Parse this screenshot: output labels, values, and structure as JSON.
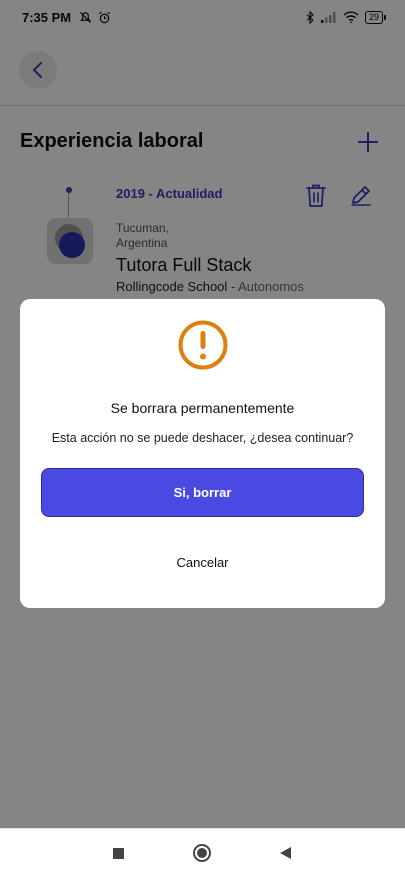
{
  "status_bar": {
    "time": "7:35 PM",
    "battery": "29",
    "icons": [
      "mute-icon",
      "alarm-icon",
      "bluetooth-icon",
      "signal-icon",
      "wifi-icon",
      "battery-icon"
    ]
  },
  "header": {
    "back_icon": "chevron-left-icon"
  },
  "section": {
    "title": "Experiencia laboral",
    "add_icon": "plus-icon"
  },
  "experience": {
    "date_range": "2019 - Actualidad",
    "location_city": "Tucuman,",
    "location_country": "Argentina",
    "job_title": "Tutora Full Stack",
    "company": "Rollingcode School",
    "separator": " - ",
    "employment_type": "Autonomos",
    "delete_icon": "trash-icon",
    "edit_icon": "pencil-icon"
  },
  "dialog": {
    "icon": "warning-icon",
    "title": "Se borrara permanentemente",
    "message": "Esta acción no se puede deshacer, ¿desea continuar?",
    "confirm_label": "Si, borrar",
    "cancel_label": "Cancelar"
  },
  "colors": {
    "accent": "#3a3ab8",
    "button": "#4a4ae2",
    "warning": "#d9820f",
    "overlay": "rgba(0,0,0,0.48)"
  },
  "nav_bar": {
    "icons": [
      "recent-apps-icon",
      "home-icon",
      "back-icon"
    ]
  }
}
